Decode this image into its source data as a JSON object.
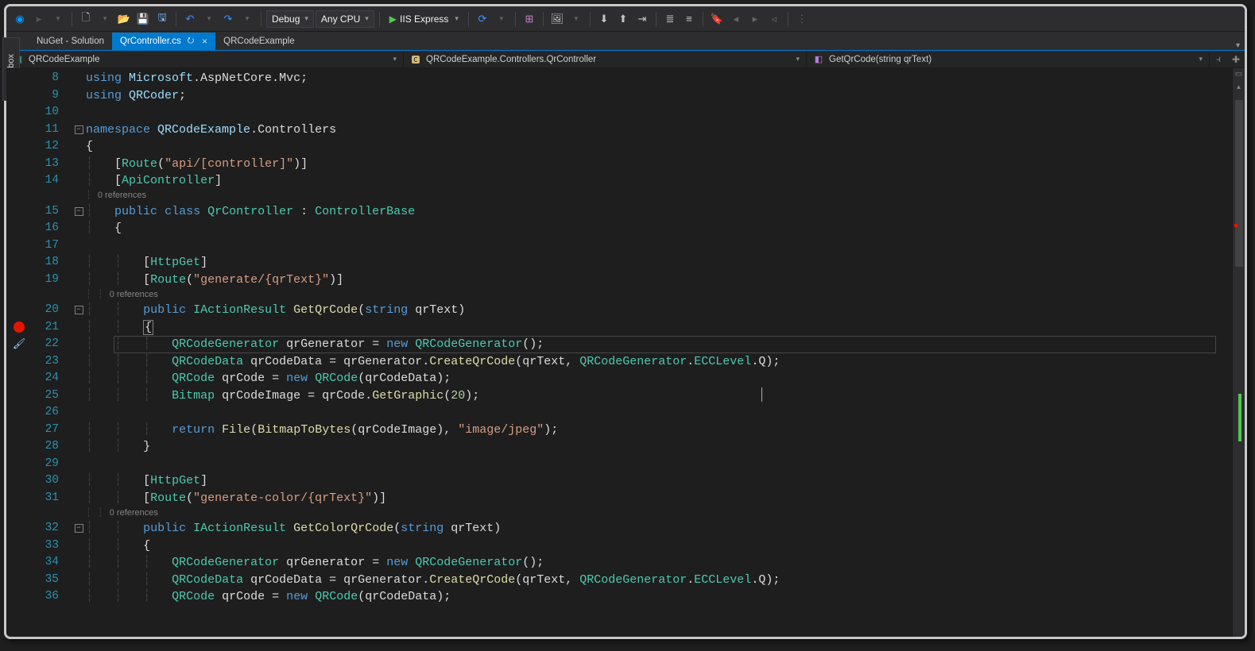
{
  "toolbar": {
    "config": "Debug",
    "platform": "Any CPU",
    "run": "IIS Express"
  },
  "toolwindow": {
    "toolbox": "Toolbox"
  },
  "tabs": [
    {
      "label": "NuGet - Solution",
      "active": false
    },
    {
      "label": "QrController.cs",
      "active": true
    },
    {
      "label": "QRCodeExample",
      "active": false
    }
  ],
  "nav": {
    "project": "QRCodeExample",
    "class": "QRCodeExample.Controllers.QrController",
    "member": "GetQrCode(string qrText)"
  },
  "refs": {
    "zero": "0 references"
  },
  "lineStart": 8,
  "code": {
    "l8": {
      "pre": "",
      "tokens": [
        [
          "kw",
          "using"
        ],
        [
          "",
          " "
        ],
        [
          "id",
          "Microsoft"
        ],
        [
          "",
          ".AspNetCore.Mvc;"
        ]
      ]
    },
    "l9": {
      "pre": "",
      "tokens": [
        [
          "kw",
          "using"
        ],
        [
          "",
          " "
        ],
        [
          "id",
          "QRCoder"
        ],
        [
          "",
          ";"
        ]
      ]
    },
    "l10": {
      "pre": "",
      "tokens": []
    },
    "l11": {
      "pre": "",
      "tokens": [
        [
          "kw",
          "namespace"
        ],
        [
          "",
          " "
        ],
        [
          "id",
          "QRCodeExample"
        ],
        [
          "",
          ".Controllers"
        ]
      ]
    },
    "l12": {
      "pre": "",
      "tokens": [
        [
          "",
          "{ "
        ]
      ]
    },
    "l13": {
      "pre": "    ",
      "tokens": [
        [
          "",
          "["
        ],
        [
          "type",
          "Route"
        ],
        [
          "",
          "("
        ],
        [
          "str",
          "\"api/[controller]\""
        ],
        [
          "",
          ")]"
        ]
      ]
    },
    "l14": {
      "pre": "    ",
      "tokens": [
        [
          "",
          "["
        ],
        [
          "type",
          "ApiController"
        ],
        [
          "",
          "]"
        ]
      ]
    },
    "ref14": "0 references",
    "l15": {
      "pre": "    ",
      "tokens": [
        [
          "kw",
          "public"
        ],
        [
          "",
          " "
        ],
        [
          "kw",
          "class"
        ],
        [
          "",
          " "
        ],
        [
          "type",
          "QrController"
        ],
        [
          "",
          " : "
        ],
        [
          "type",
          "ControllerBase"
        ]
      ]
    },
    "l16": {
      "pre": "    ",
      "tokens": [
        [
          "",
          "{"
        ]
      ]
    },
    "l17": {
      "pre": "",
      "tokens": []
    },
    "l18": {
      "pre": "        ",
      "tokens": [
        [
          "",
          "["
        ],
        [
          "type",
          "HttpGet"
        ],
        [
          "",
          "]"
        ]
      ]
    },
    "l19": {
      "pre": "        ",
      "tokens": [
        [
          "",
          "["
        ],
        [
          "type",
          "Route"
        ],
        [
          "",
          "("
        ],
        [
          "str",
          "\"generate/{qrText}\""
        ],
        [
          "",
          ")]"
        ]
      ]
    },
    "ref19": "0 references",
    "l20": {
      "pre": "        ",
      "tokens": [
        [
          "kw",
          "public"
        ],
        [
          "",
          " "
        ],
        [
          "type",
          "IActionResult"
        ],
        [
          "",
          " "
        ],
        [
          "mtd",
          "GetQrCode"
        ],
        [
          "",
          "("
        ],
        [
          "kw",
          "string"
        ],
        [
          "",
          " qrText)"
        ]
      ]
    },
    "l21": {
      "pre": "        ",
      "tokens": [
        [
          "",
          "{"
        ]
      ]
    },
    "l22": {
      "pre": "            ",
      "tokens": [
        [
          "type",
          "QRCodeGenerator"
        ],
        [
          "",
          " qrGenerator = "
        ],
        [
          "kw",
          "new"
        ],
        [
          "",
          " "
        ],
        [
          "type",
          "QRCodeGenerator"
        ],
        [
          "",
          "();"
        ]
      ]
    },
    "l23": {
      "pre": "            ",
      "tokens": [
        [
          "type",
          "QRCodeData"
        ],
        [
          "",
          " qrCodeData = qrGenerator."
        ],
        [
          "mtd",
          "CreateQrCode"
        ],
        [
          "",
          "(qrText, "
        ],
        [
          "type",
          "QRCodeGenerator"
        ],
        [
          "",
          "."
        ],
        [
          "type",
          "ECCLevel"
        ],
        [
          "",
          ".Q);"
        ]
      ]
    },
    "l24": {
      "pre": "            ",
      "tokens": [
        [
          "type",
          "QRCode"
        ],
        [
          "",
          " qrCode = "
        ],
        [
          "kw",
          "new"
        ],
        [
          "",
          " "
        ],
        [
          "type",
          "QRCode"
        ],
        [
          "",
          "(qrCodeData);"
        ]
      ]
    },
    "l25": {
      "pre": "            ",
      "tokens": [
        [
          "type",
          "Bitmap"
        ],
        [
          "",
          " qrCodeImage = qrCode."
        ],
        [
          "mtd",
          "GetGraphic"
        ],
        [
          "",
          "("
        ],
        [
          "num",
          "20"
        ],
        [
          "",
          ");"
        ]
      ]
    },
    "l26": {
      "pre": "",
      "tokens": []
    },
    "l27": {
      "pre": "            ",
      "tokens": [
        [
          "kw",
          "return"
        ],
        [
          "",
          " "
        ],
        [
          "mtd",
          "File"
        ],
        [
          "",
          "("
        ],
        [
          "mtd",
          "BitmapToBytes"
        ],
        [
          "",
          "(qrCodeImage), "
        ],
        [
          "str",
          "\"image/jpeg\""
        ],
        [
          "",
          ");"
        ]
      ]
    },
    "l28": {
      "pre": "        ",
      "tokens": [
        [
          "",
          "}"
        ]
      ]
    },
    "l29": {
      "pre": "",
      "tokens": []
    },
    "l30": {
      "pre": "        ",
      "tokens": [
        [
          "",
          "["
        ],
        [
          "type",
          "HttpGet"
        ],
        [
          "",
          "]"
        ]
      ]
    },
    "l31": {
      "pre": "        ",
      "tokens": [
        [
          "",
          "["
        ],
        [
          "type",
          "Route"
        ],
        [
          "",
          "("
        ],
        [
          "str",
          "\"generate-color/{qrText}\""
        ],
        [
          "",
          ")]"
        ]
      ]
    },
    "ref31": "0 references",
    "l32": {
      "pre": "        ",
      "tokens": [
        [
          "kw",
          "public"
        ],
        [
          "",
          " "
        ],
        [
          "type",
          "IActionResult"
        ],
        [
          "",
          " "
        ],
        [
          "mtd",
          "GetColorQrCode"
        ],
        [
          "",
          "("
        ],
        [
          "kw",
          "string"
        ],
        [
          "",
          " qrText)"
        ]
      ]
    },
    "l33": {
      "pre": "        ",
      "tokens": [
        [
          "",
          "{"
        ]
      ]
    },
    "l34": {
      "pre": "            ",
      "tokens": [
        [
          "type",
          "QRCodeGenerator"
        ],
        [
          "",
          " qrGenerator = "
        ],
        [
          "kw",
          "new"
        ],
        [
          "",
          " "
        ],
        [
          "type",
          "QRCodeGenerator"
        ],
        [
          "",
          "();"
        ]
      ]
    },
    "l35": {
      "pre": "            ",
      "tokens": [
        [
          "type",
          "QRCodeData"
        ],
        [
          "",
          " qrCodeData = qrGenerator."
        ],
        [
          "mtd",
          "CreateQrCode"
        ],
        [
          "",
          "(qrText, "
        ],
        [
          "type",
          "QRCodeGenerator"
        ],
        [
          "",
          "."
        ],
        [
          "type",
          "ECCLevel"
        ],
        [
          "",
          ".Q);"
        ]
      ]
    },
    "l36": {
      "pre": "            ",
      "tokens": [
        [
          "type",
          "QRCode"
        ],
        [
          "",
          " qrCode = "
        ],
        [
          "kw",
          "new"
        ],
        [
          "",
          " "
        ],
        [
          "type",
          "QRCode"
        ],
        [
          "",
          "(qrCodeData);"
        ]
      ]
    }
  }
}
